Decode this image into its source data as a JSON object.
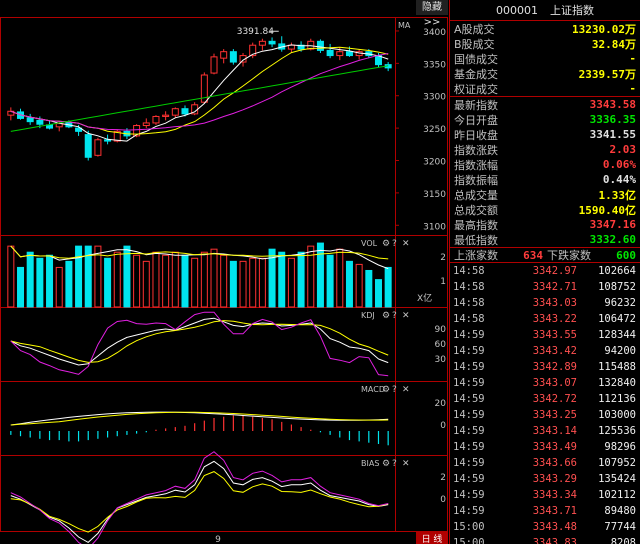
{
  "colors": {
    "up": "#ff3232",
    "down": "#00e5ee",
    "ma5": "#ffffff",
    "ma10": "#ffff00",
    "ma20": "#e020e0",
    "ma60": "#00cc00",
    "grid": "#b00000",
    "green": "#00e600",
    "yellow": "#ffff00"
  },
  "toolbar": {
    "hide_label": "隐藏>>"
  },
  "main_chart": {
    "indicator": "MA",
    "y_ticks": [
      "3400",
      "3350",
      "3300",
      "3250",
      "3200",
      "3150",
      "3100"
    ],
    "high_label": "3391.84"
  },
  "volume_panel": {
    "label": "VOL",
    "icons": [
      "⚙",
      "?",
      "✕"
    ],
    "y_ticks": [
      "2",
      "1"
    ],
    "unit": "X亿"
  },
  "kdj_panel": {
    "label": "KDJ",
    "icons": [
      "⚙",
      "?",
      "✕"
    ],
    "y_ticks": [
      "90",
      "60",
      "30"
    ]
  },
  "macd_panel": {
    "label": "MACD",
    "icons": [
      "⚙",
      "?",
      "✕"
    ],
    "y_ticks": [
      "20",
      "0"
    ]
  },
  "bias_panel": {
    "label": "BIAS",
    "icons": [
      "⚙",
      "?",
      "✕"
    ],
    "y_ticks": [
      "2",
      "0"
    ]
  },
  "bottom_bar": {
    "x_label": "9",
    "period_label": "日 线"
  },
  "chart_data": {
    "type": "candlestick",
    "candles": [
      {
        "o": 3270,
        "h": 3282,
        "l": 3262,
        "c": 3276
      },
      {
        "o": 3275,
        "h": 3280,
        "l": 3263,
        "c": 3265
      },
      {
        "o": 3266,
        "h": 3272,
        "l": 3255,
        "c": 3260
      },
      {
        "o": 3262,
        "h": 3268,
        "l": 3250,
        "c": 3256
      },
      {
        "o": 3255,
        "h": 3262,
        "l": 3248,
        "c": 3250
      },
      {
        "o": 3252,
        "h": 3260,
        "l": 3245,
        "c": 3257
      },
      {
        "o": 3258,
        "h": 3262,
        "l": 3250,
        "c": 3252
      },
      {
        "o": 3250,
        "h": 3255,
        "l": 3238,
        "c": 3245
      },
      {
        "o": 3240,
        "h": 3246,
        "l": 3200,
        "c": 3205
      },
      {
        "o": 3208,
        "h": 3235,
        "l": 3206,
        "c": 3232
      },
      {
        "o": 3232,
        "h": 3240,
        "l": 3225,
        "c": 3230
      },
      {
        "o": 3230,
        "h": 3248,
        "l": 3228,
        "c": 3245
      },
      {
        "o": 3245,
        "h": 3250,
        "l": 3233,
        "c": 3238
      },
      {
        "o": 3238,
        "h": 3256,
        "l": 3236,
        "c": 3254
      },
      {
        "o": 3254,
        "h": 3265,
        "l": 3250,
        "c": 3258
      },
      {
        "o": 3258,
        "h": 3270,
        "l": 3255,
        "c": 3268
      },
      {
        "o": 3268,
        "h": 3276,
        "l": 3262,
        "c": 3270
      },
      {
        "o": 3270,
        "h": 3282,
        "l": 3266,
        "c": 3280
      },
      {
        "o": 3280,
        "h": 3285,
        "l": 3268,
        "c": 3272
      },
      {
        "o": 3272,
        "h": 3290,
        "l": 3270,
        "c": 3286
      },
      {
        "o": 3290,
        "h": 3336,
        "l": 3288,
        "c": 3332
      },
      {
        "o": 3335,
        "h": 3365,
        "l": 3333,
        "c": 3360
      },
      {
        "o": 3358,
        "h": 3372,
        "l": 3350,
        "c": 3368
      },
      {
        "o": 3368,
        "h": 3372,
        "l": 3348,
        "c": 3352
      },
      {
        "o": 3352,
        "h": 3366,
        "l": 3345,
        "c": 3362
      },
      {
        "o": 3362,
        "h": 3382,
        "l": 3358,
        "c": 3378
      },
      {
        "o": 3378,
        "h": 3388,
        "l": 3370,
        "c": 3384
      },
      {
        "o": 3384,
        "h": 3390,
        "l": 3375,
        "c": 3380
      },
      {
        "o": 3380,
        "h": 3391.84,
        "l": 3368,
        "c": 3372
      },
      {
        "o": 3372,
        "h": 3382,
        "l": 3366,
        "c": 3378
      },
      {
        "o": 3378,
        "h": 3384,
        "l": 3368,
        "c": 3372
      },
      {
        "o": 3372,
        "h": 3388,
        "l": 3370,
        "c": 3384
      },
      {
        "o": 3384,
        "h": 3387,
        "l": 3366,
        "c": 3370
      },
      {
        "o": 3370,
        "h": 3380,
        "l": 3358,
        "c": 3362
      },
      {
        "o": 3362,
        "h": 3375,
        "l": 3355,
        "c": 3368
      },
      {
        "o": 3368,
        "h": 3376,
        "l": 3360,
        "c": 3362
      },
      {
        "o": 3362,
        "h": 3372,
        "l": 3356,
        "c": 3368
      },
      {
        "o": 3368,
        "h": 3372,
        "l": 3358,
        "c": 3362
      },
      {
        "o": 3362,
        "h": 3366,
        "l": 3344,
        "c": 3348
      },
      {
        "o": 3348,
        "h": 3352,
        "l": 3338,
        "c": 3343
      }
    ],
    "volume": [
      2.0,
      1.3,
      1.8,
      1.6,
      1.7,
      1.3,
      1.5,
      2.0,
      2.0,
      2.0,
      1.6,
      1.8,
      2.0,
      1.7,
      1.5,
      1.8,
      1.7,
      1.8,
      1.7,
      1.6,
      1.8,
      1.9,
      1.7,
      1.5,
      1.5,
      1.6,
      1.6,
      1.9,
      1.8,
      1.6,
      1.8,
      2.0,
      2.1,
      1.7,
      1.9,
      1.5,
      1.4,
      1.2,
      0.9,
      1.3
    ],
    "ylim": [
      3085,
      3420
    ]
  },
  "header": {
    "code": "000001",
    "name": "上证指数"
  },
  "stats": [
    {
      "label": "A股成交",
      "value": "13230.02万",
      "color": "#ffff00"
    },
    {
      "label": "B股成交",
      "value": "32.84万",
      "color": "#ffff00"
    },
    {
      "label": "国债成交",
      "value": "-",
      "color": "#ffff00"
    },
    {
      "label": "基金成交",
      "value": "2339.57万",
      "color": "#ffff00"
    },
    {
      "label": "权证成交",
      "value": "-",
      "color": "#ffff00"
    }
  ],
  "index_stats": [
    {
      "label": "最新指数",
      "value": "3343.58",
      "color": "#ff3c3c"
    },
    {
      "label": "今日开盘",
      "value": "3336.35",
      "color": "#00e600"
    },
    {
      "label": "昨日收盘",
      "value": "3341.55",
      "color": "#e0e0e0"
    },
    {
      "label": "指数涨跌",
      "value": "2.03",
      "color": "#ff3c3c"
    },
    {
      "label": "指数涨幅",
      "value": "0.06%",
      "color": "#ff3c3c"
    },
    {
      "label": "指数振幅",
      "value": "0.44%",
      "color": "#e0e0e0"
    },
    {
      "label": "总成交量",
      "value": "1.33亿",
      "color": "#ffff00"
    },
    {
      "label": "总成交额",
      "value": "1590.40亿",
      "color": "#ffff00"
    },
    {
      "label": "最高指数",
      "value": "3347.16",
      "color": "#ff3c3c"
    },
    {
      "label": "最低指数",
      "value": "3332.60",
      "color": "#00e600"
    }
  ],
  "advance": {
    "up_label": "上涨家数",
    "up_value": "634",
    "down_label": "下跌家数",
    "down_value": "600"
  },
  "ticks": [
    {
      "time": "14:58",
      "price": "3342.97",
      "vol": "102664"
    },
    {
      "time": "14:58",
      "price": "3342.71",
      "vol": "108752"
    },
    {
      "time": "14:58",
      "price": "3343.03",
      "vol": "96232"
    },
    {
      "time": "14:58",
      "price": "3343.22",
      "vol": "106472"
    },
    {
      "time": "14:59",
      "price": "3343.55",
      "vol": "128344"
    },
    {
      "time": "14:59",
      "price": "3343.42",
      "vol": "94200"
    },
    {
      "time": "14:59",
      "price": "3342.89",
      "vol": "115488"
    },
    {
      "time": "14:59",
      "price": "3343.07",
      "vol": "132840"
    },
    {
      "time": "14:59",
      "price": "3342.72",
      "vol": "112136"
    },
    {
      "time": "14:59",
      "price": "3343.25",
      "vol": "103000"
    },
    {
      "time": "14:59",
      "price": "3343.14",
      "vol": "125536"
    },
    {
      "time": "14:59",
      "price": "3343.49",
      "vol": "98296"
    },
    {
      "time": "14:59",
      "price": "3343.66",
      "vol": "107952"
    },
    {
      "time": "14:59",
      "price": "3343.29",
      "vol": "135424"
    },
    {
      "time": "14:59",
      "price": "3343.34",
      "vol": "102112"
    },
    {
      "time": "14:59",
      "price": "3343.71",
      "vol": "89480"
    },
    {
      "time": "15:00",
      "price": "3343.48",
      "vol": "77744"
    },
    {
      "time": "15:00",
      "price": "3343.83",
      "vol": "8208"
    }
  ]
}
